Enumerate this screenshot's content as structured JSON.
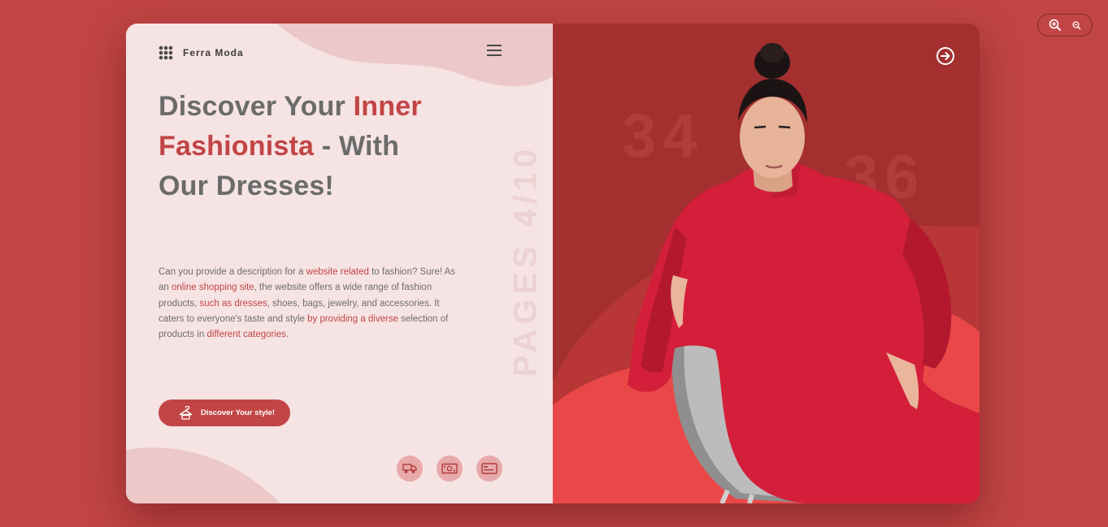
{
  "zoom": {
    "zoom_in_icon": "zoom-in-icon",
    "zoom_out_icon": "zoom-out-icon"
  },
  "brand": {
    "name": "Ferra Moda",
    "logo_icon": "grid-dots-icon"
  },
  "menu_icon": "hamburger-menu-icon",
  "headline": {
    "part1": "Discover Your ",
    "accent1": "Inner",
    "accent2": "Fashionista",
    "part2": " - With",
    "part3": "Our Dresses!"
  },
  "vertical_label": "PAGES 4/10",
  "description": {
    "t1": "Can you provide a description for a ",
    "l1": "website related",
    "t2": " to fashion? Sure! As an ",
    "l2": "online shopping site",
    "t3": ", the website offers a wide range of fashion products, ",
    "l3": "such as dresses",
    "t4": ", shoes, bags, jewelry, and accessories. It caters to everyone's taste and style ",
    "l4": "by providing a diverse",
    "t5": " selection of products in ",
    "l5": "different categories",
    "t6": "."
  },
  "cta": {
    "label": "Discover Your style!",
    "icon": "hanger-icon"
  },
  "features": [
    {
      "icon": "delivery-truck-icon"
    },
    {
      "icon": "money-icon"
    },
    {
      "icon": "credit-card-icon"
    }
  ],
  "sizes": [
    "34",
    "36"
  ],
  "next_icon": "arrow-right-circle-icon",
  "colors": {
    "background": "#c24545",
    "accent": "#c24545",
    "left_panel": "#f6e3e3",
    "right_panel": "#a32f2f",
    "dress": "#d41f3a",
    "text": "#6b6b6b"
  }
}
